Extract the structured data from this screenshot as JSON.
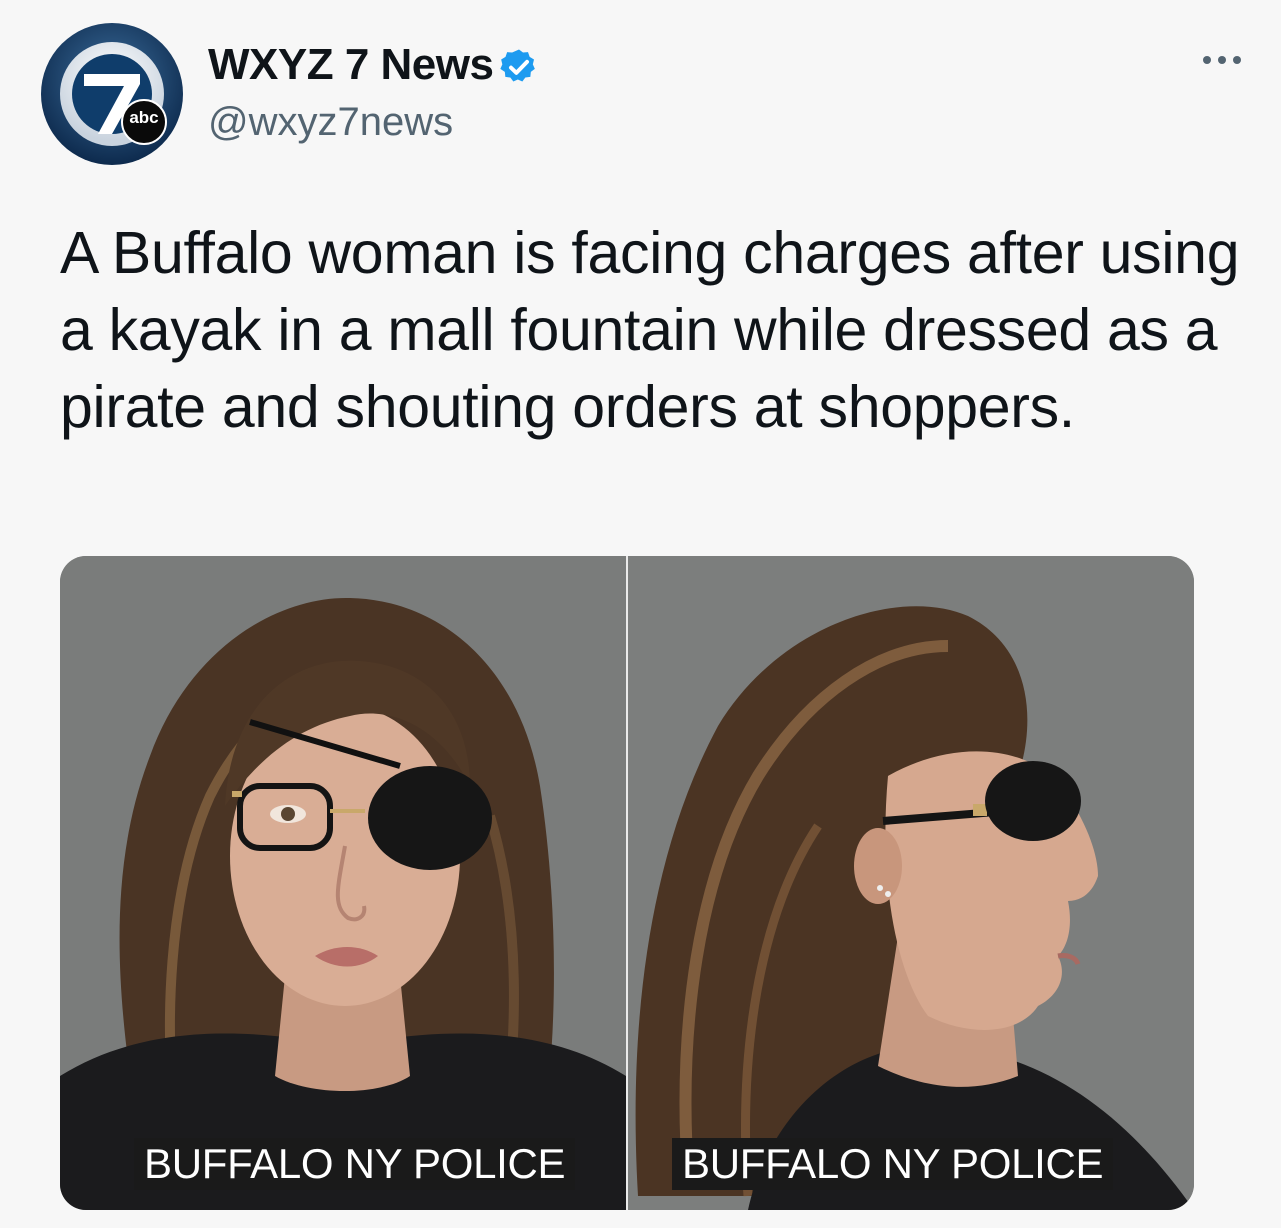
{
  "post": {
    "author_name": "WXYZ 7 News",
    "handle": "@wxyz7news",
    "verified": true,
    "avatar": {
      "icon": "abc-7-logo-icon",
      "badge_text": "abc",
      "number": "7"
    },
    "more_icon": "more-horizontal-icon",
    "text": "A Buffalo woman is facing charges after using a kayak in a mall fountain while dressed as a pirate and shouting orders at shoppers.",
    "media": [
      {
        "kind": "photo",
        "view": "front",
        "caption": "BUFFALO NY POLICE"
      },
      {
        "kind": "photo",
        "view": "profile",
        "caption": "BUFFALO  NY POLICE"
      }
    ]
  },
  "colors": {
    "background": "#f7f7f7",
    "text": "#0f1419",
    "secondary_text": "#536471",
    "verified": "#1d9bf0",
    "caption_bg": "#1a1a1a"
  }
}
